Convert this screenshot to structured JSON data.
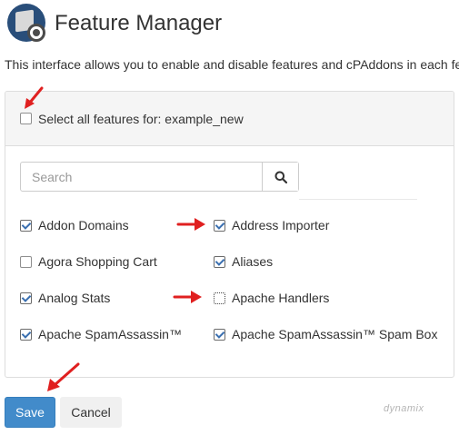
{
  "header": {
    "title": "Feature Manager"
  },
  "intro": "This interface allows you to enable and disable features and cPAddons in each feature list.",
  "panel": {
    "select_all_label": "Select all features for: example_new",
    "select_all_checked": false
  },
  "search": {
    "placeholder": "Search"
  },
  "features": [
    {
      "label": "Addon Domains",
      "checked": true
    },
    {
      "label": "Address Importer",
      "checked": true
    },
    {
      "label": "Agora Shopping Cart",
      "checked": false
    },
    {
      "label": "Aliases",
      "checked": true
    },
    {
      "label": "Analog Stats",
      "checked": true
    },
    {
      "label": "Apache Handlers",
      "checked": false
    },
    {
      "label": "Apache SpamAssassin™",
      "checked": true
    },
    {
      "label": "Apache SpamAssassin™ Spam Box",
      "checked": true
    }
  ],
  "buttons": {
    "save": "Save",
    "cancel": "Cancel"
  },
  "watermark": "dynamix",
  "colors": {
    "primary": "#428bca",
    "annotation_arrow": "#e02020",
    "logo_bg": "#294e7a"
  }
}
